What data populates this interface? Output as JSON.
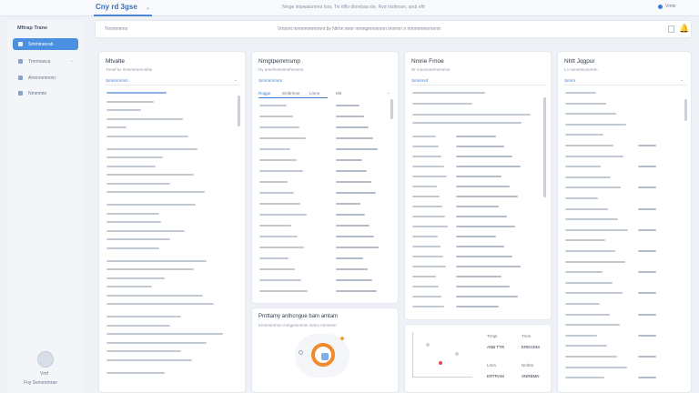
{
  "app": {
    "title": "Cny rd 3gse",
    "status_text": "Nmge lmpwalamrea fsra, Tiv rtlfis dtmebaa ste, Rvd ntsltmsm, amb eftr",
    "user_label": "Vmte"
  },
  "sidebar": {
    "heading": "Mftrap Trane",
    "items": [
      {
        "label": "Smmtranrab",
        "active": true
      },
      {
        "label": "Tmrmswca",
        "active": false
      },
      {
        "label": "Amrnmmmnn",
        "active": false
      },
      {
        "label": "Nmmmte",
        "active": false
      }
    ],
    "user_name": "Vmf",
    "user_role": "Fny Svmmrmran"
  },
  "toolbar": {
    "left_label": "Trnmmmnn",
    "center_text": "Vmnmt mmmmmmrmnt bv Ntrhn mmr mmngmnmnmn lmrrmn n mmmmmnrnnmr"
  },
  "columns": [
    {
      "title": "Mtvalte",
      "subtitle": "Trmef kv nhmmmrmnnhm",
      "filter": "Smmrmrmm"
    },
    {
      "title": "Nmgtpemmsmp",
      "subtitle": "Hy nmnfmmmmnhmmrm",
      "filter": "Smrmmrmmr",
      "tabs": [
        "Rogge",
        "Smbrmne",
        "Lmnn",
        "Mlr"
      ]
    },
    {
      "title": "Nmrie Fmoe",
      "subtitle": "Rr mmnmmrmnmmm",
      "filter": "Smmrnnf"
    },
    {
      "title": "Nhtt Jqgpur",
      "subtitle": "Ln mmmmnmrmm",
      "filter": "Smrm"
    }
  ],
  "donut_panel": {
    "title": "Prnttamy anthcngue bam amtam",
    "subtitle": "Kmmmnrmm mmgnmmmm mmm mmmnm"
  },
  "col3_panel": {
    "stats": [
      {
        "label": "Trmpl",
        "value": "ANB TTR"
      },
      {
        "label": "Tmrs",
        "value": "EREGDM"
      },
      {
        "label": "Lmm",
        "value": "ERTRAM"
      },
      {
        "label": "Nmbm",
        "value": "SNRBMN"
      }
    ]
  },
  "colors": {
    "accent": "#4a8fe0",
    "donut": "#f08a2c",
    "bell": "#e0a020"
  }
}
